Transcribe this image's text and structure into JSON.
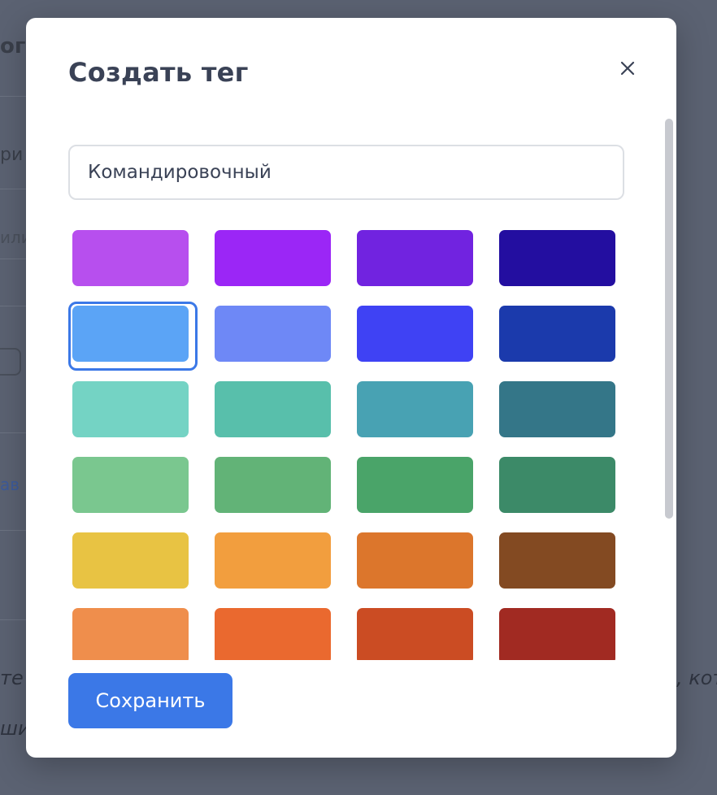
{
  "modal": {
    "title": "Создать тег",
    "close_symbol": "×",
    "name_input": {
      "value": "Командировочный",
      "placeholder": ""
    },
    "selected_color": "#5ba4f6",
    "colors": [
      "#b74fee",
      "#9b26f6",
      "#7123e0",
      "#230ea0",
      "#5ba4f6",
      "#6e88f6",
      "#3f42f4",
      "#1b3aac",
      "#74d3c4",
      "#58bfab",
      "#48a2b3",
      "#347688",
      "#7ac78f",
      "#62b377",
      "#4aa469",
      "#3c8a68",
      "#e8c343",
      "#f29e3e",
      "#dc762c",
      "#834a22",
      "#ef8e4c",
      "#ea692f",
      "#cb4c23",
      "#a12a22"
    ],
    "save_label": "Сохранить"
  },
  "background": {
    "fragments": [
      "ого",
      "ри",
      "или",
      "ав",
      "те",
      "ши",
      ", кот"
    ]
  }
}
